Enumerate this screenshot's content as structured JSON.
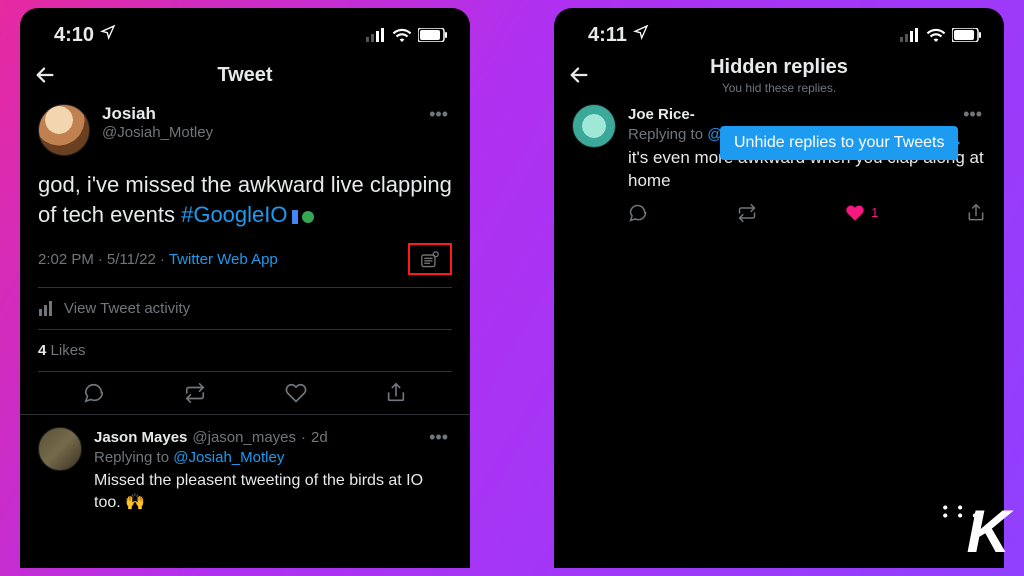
{
  "left": {
    "status_time": "4:10",
    "title": "Tweet",
    "author": {
      "name": "Josiah",
      "handle": "@Josiah_Motley"
    },
    "tweet_text_prefix": "god, i've missed the awkward live clapping of tech events ",
    "tweet_hashtag": "#GoogleIO",
    "meta": {
      "time": "2:02 PM",
      "date": "5/11/22",
      "source": "Twitter Web App"
    },
    "view_activity": "View Tweet activity",
    "likes_count": "4",
    "likes_label": "Likes",
    "reply": {
      "name": "Jason Mayes",
      "handle": "@jason_mayes",
      "age": "2d",
      "replying_label": "Replying to",
      "replying_handle": "@Josiah_Motley",
      "text": "Missed the pleasent tweeting of the birds at IO too. 🙌"
    }
  },
  "right": {
    "status_time": "4:11",
    "title": "Hidden replies",
    "subtitle": "You hid these replies.",
    "tooltip": "Unhide replies to your Tweets",
    "reply": {
      "name": "Joe Rice-",
      "replying_label": "Replying to",
      "replying_handle": "@Josiah_Motley",
      "text": "it's even more awkward when you clap along at home",
      "like_count": "1"
    }
  },
  "watermark": "K"
}
